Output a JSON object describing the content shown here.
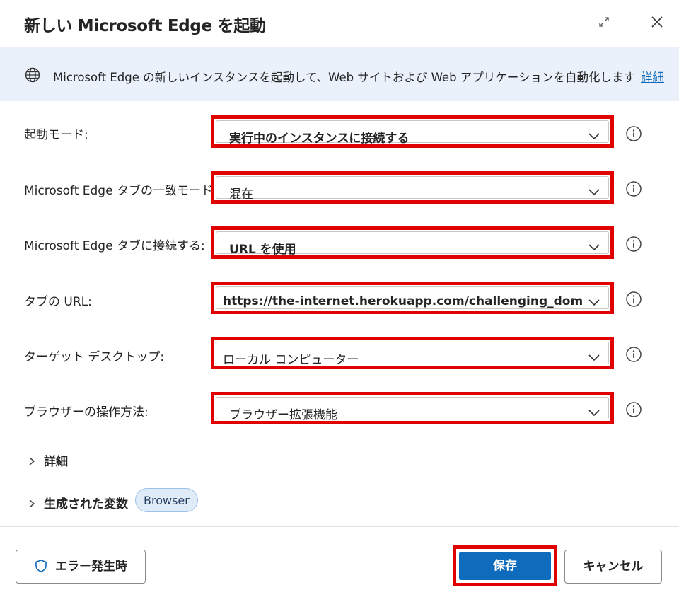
{
  "dialog": {
    "title": "新しい Microsoft Edge を起動",
    "icons": {
      "expand": "expand-icon",
      "close": "close-icon"
    }
  },
  "banner": {
    "icon": "globe-icon",
    "text": "Microsoft Edge の新しいインスタンスを起動して、Web サイトおよび Web アプリケーションを自動化します",
    "link": "詳細"
  },
  "fields": [
    {
      "label": "起動モード:",
      "value": "実行中のインスタンスに接続する"
    },
    {
      "label": "Microsoft Edge タブの一致モード:",
      "value": "混在"
    },
    {
      "label": "Microsoft Edge タブに接続する:",
      "value": "URL を使用"
    },
    {
      "label": "タブの URL:",
      "value": "https://the-internet.herokuapp.com/challenging_dom"
    },
    {
      "label": "ターゲット デスクトップ:",
      "value": "ローカル コンピューター"
    },
    {
      "label": "ブラウザーの操作方法:",
      "value": "ブラウザー拡張機能"
    }
  ],
  "sections": {
    "details": "詳細",
    "generated_variables": "生成された変数",
    "variable_chip": "Browser"
  },
  "footer": {
    "on_error": "エラー発生時",
    "save": "保存",
    "cancel": "キャンセル"
  },
  "colors": {
    "highlight": "#e00000",
    "primary": "#0f6cbd",
    "banner_bg": "#eaf1fb"
  }
}
